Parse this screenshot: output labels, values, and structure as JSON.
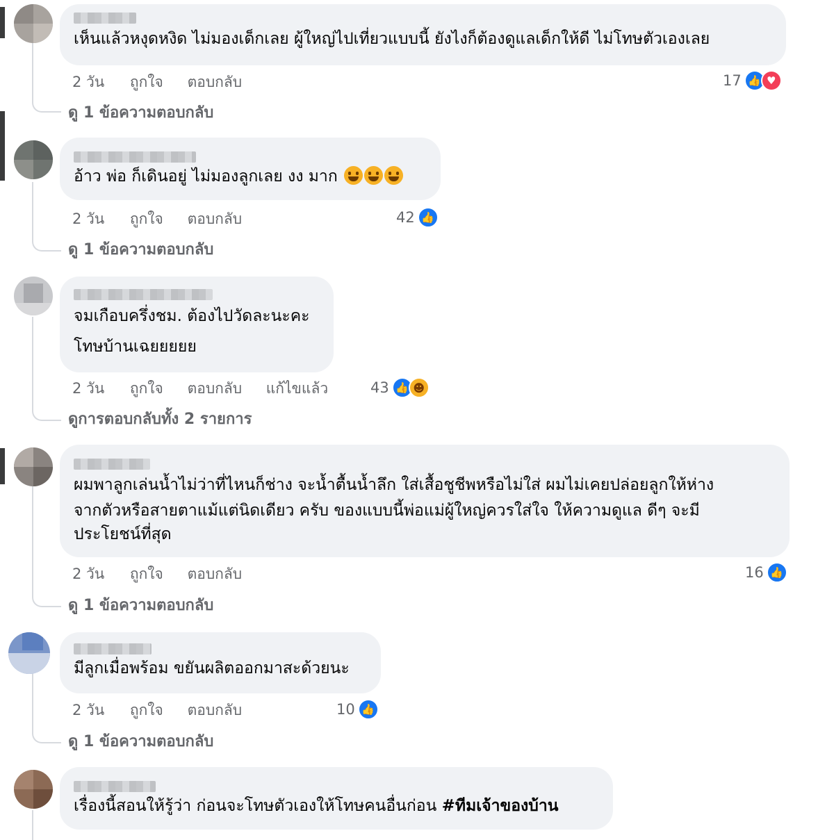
{
  "comments": [
    {
      "text": "เห็นแล้วหงุดหงิด ไม่มองเด็กเลย ผู้ใหญ่ไปเที่ยวแบบนี้ ยังไงก็ต้องดูแลเด็กให้ดี ไม่โทษตัวเองเลย",
      "time": "2 วัน",
      "like": "ถูกใจ",
      "reply": "ตอบกลับ",
      "reaction_count": "17",
      "reactions": [
        "like-icon",
        "love-icon"
      ],
      "replies_link": "ดู 1 ข้อความตอบกลับ"
    },
    {
      "text": "อ้าว พ่อ ก็เดินอยู่ ไม่มองลูกเลย งง มาก",
      "emoji": [
        "laughing-emoji",
        "laughing-emoji",
        "laughing-emoji"
      ],
      "time": "2 วัน",
      "like": "ถูกใจ",
      "reply": "ตอบกลับ",
      "reaction_count": "42",
      "reactions": [
        "like-icon"
      ],
      "replies_link": "ดู 1 ข้อความตอบกลับ"
    },
    {
      "text_lines": [
        "จมเกือบครึ่งชม. ต้องไปวัดละนะคะ",
        "โทษบ้านเฉยยยยย"
      ],
      "time": "2 วัน",
      "like": "ถูกใจ",
      "reply": "ตอบกลับ",
      "edited": "แก้ไขแล้ว",
      "reaction_count": "43",
      "reactions": [
        "like-icon",
        "haha-icon"
      ],
      "replies_link": "ดูการตอบกลับทั้ง 2 รายการ"
    },
    {
      "text_lines": [
        "ผมพาลูกเล่นน้ำไม่ว่าที่ไหนก็ช่าง จะน้ำตื้นน้ำลึก ใส่เสื้อชูชีพหรือไม่ใส่ ผมไม่เคยปล่อยลูกให้ห่าง",
        "จากตัวหรือสายตาแม้แต่นิดเดียว ครับ ของแบบนี้พ่อแม่ผู้ใหญ่ควรใส่ใจ ให้ความดูแล ดีๆ จะมี",
        "ประโยชน์ที่สุด"
      ],
      "time": "2 วัน",
      "like": "ถูกใจ",
      "reply": "ตอบกลับ",
      "reaction_count": "16",
      "reactions": [
        "like-icon"
      ],
      "replies_link": "ดู 1 ข้อความตอบกลับ"
    },
    {
      "text": "มีลูกเมื่อพร้อม ขยันผลิตออกมาสะด้วยนะ",
      "time": "2 วัน",
      "like": "ถูกใจ",
      "reply": "ตอบกลับ",
      "reaction_count": "10",
      "reactions": [
        "like-icon"
      ],
      "replies_link": "ดู 1 ข้อความตอบกลับ"
    },
    {
      "text": "เรื่องนี้สอนให้รู้ว่า ก่อนจะโทษตัวเองให้โทษคนอื่นก่อน ",
      "hashtag": "#ทีมเจ้าของบ้าน"
    }
  ],
  "colors": {
    "bubble": "#f0f2f5",
    "meta_text": "#65676b",
    "like_blue": "#1877f2",
    "love_red": "#f33e58",
    "haha_yellow": "#f7b125"
  }
}
